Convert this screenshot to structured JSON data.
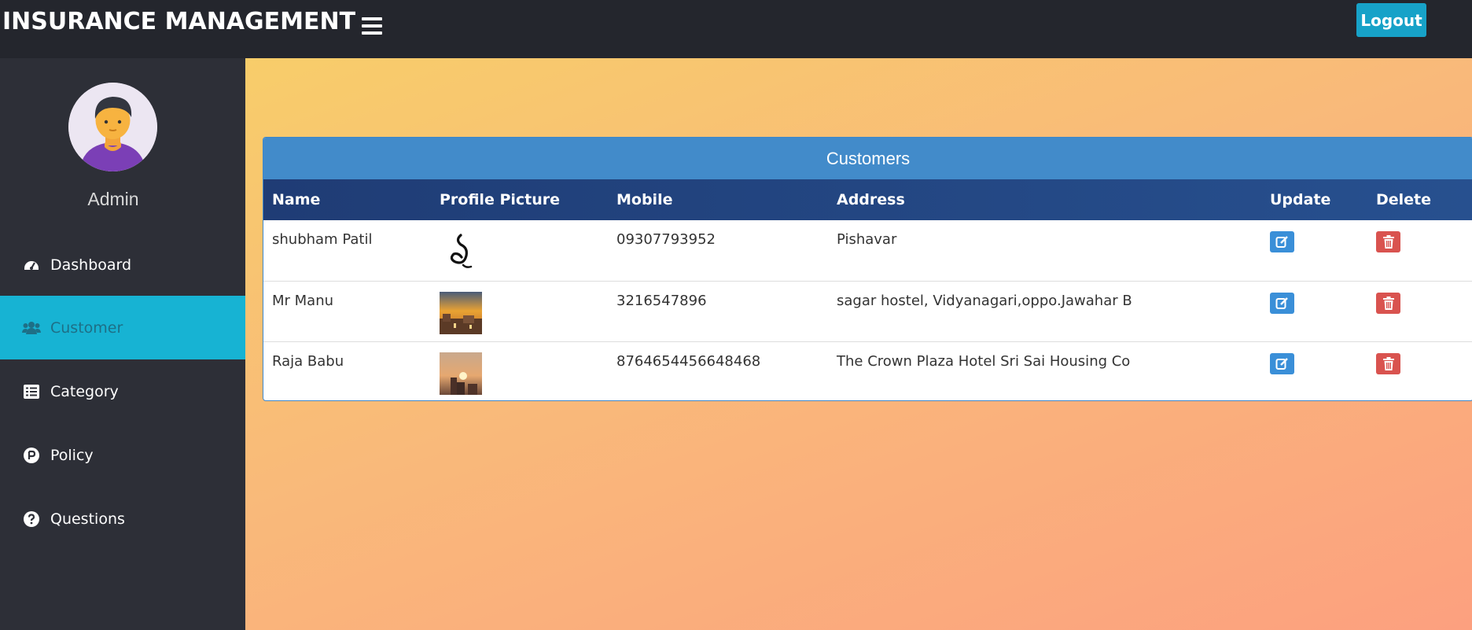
{
  "header": {
    "brand": "INSURANCE MANAGEMENT",
    "logout_label": "Logout"
  },
  "sidebar": {
    "admin_name": "Admin",
    "items": [
      {
        "label": "Dashboard",
        "icon": "tachometer-icon",
        "active": false
      },
      {
        "label": "Customer",
        "icon": "users-icon",
        "active": true
      },
      {
        "label": "Category",
        "icon": "list-icon",
        "active": false
      },
      {
        "label": "Policy",
        "icon": "parking-circle-icon",
        "active": false
      },
      {
        "label": "Questions",
        "icon": "question-circle-icon",
        "active": false
      }
    ]
  },
  "customers_panel": {
    "title": "Customers",
    "columns": [
      "Name",
      "Profile Picture",
      "Mobile",
      "Address",
      "Update",
      "Delete"
    ],
    "rows": [
      {
        "name": "shubham Patil",
        "picture": "calligraphy-symbol",
        "mobile": "09307793952",
        "address": "Pishavar"
      },
      {
        "name": "Mr Manu",
        "picture": "sunset-rooftop-photo",
        "mobile": "3216547896",
        "address": "sagar hostel, Vidyanagari,oppo.Jawahar B"
      },
      {
        "name": "Raja Babu",
        "picture": "sunset-buildings-photo",
        "mobile": "8764654456648468",
        "address": "The Crown Plaza Hotel Sri Sai Housing Co"
      }
    ]
  },
  "colors": {
    "topbar": "#24262d",
    "sidebar": "#2d2f37",
    "active_item": "#17b3d3",
    "panel_header": "#428bca",
    "table_header": "#1f3c75",
    "update_button": "#3a8fd8",
    "delete_button": "#d9534f",
    "logout_button": "#17a2c8"
  }
}
